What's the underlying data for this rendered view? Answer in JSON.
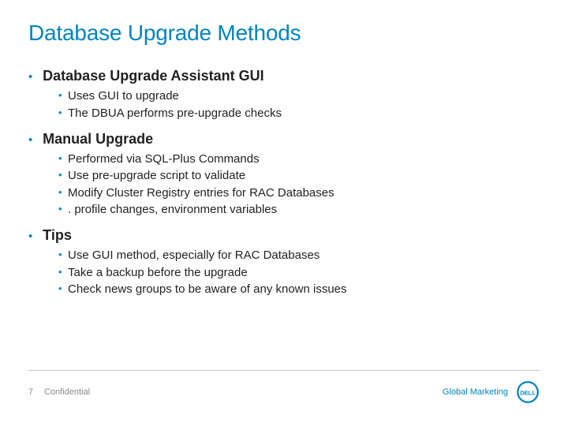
{
  "title": "Database Upgrade Methods",
  "sections": [
    {
      "heading": "Database Upgrade Assistant GUI",
      "items": [
        "Uses GUI to upgrade",
        "The DBUA performs pre-upgrade checks"
      ]
    },
    {
      "heading": "Manual Upgrade",
      "items": [
        "Performed via SQL-Plus Commands",
        "Use pre-upgrade script to validate",
        "Modify Cluster Registry entries for RAC Databases",
        ". profile changes, environment variables"
      ]
    },
    {
      "heading": "Tips",
      "items": [
        "Use GUI method, especially for RAC Databases",
        "Take a backup before the upgrade",
        "Check news groups to be aware of any known issues"
      ]
    }
  ],
  "footer": {
    "page": "7",
    "confidential": "Confidential",
    "tagline": "Global Marketing"
  }
}
